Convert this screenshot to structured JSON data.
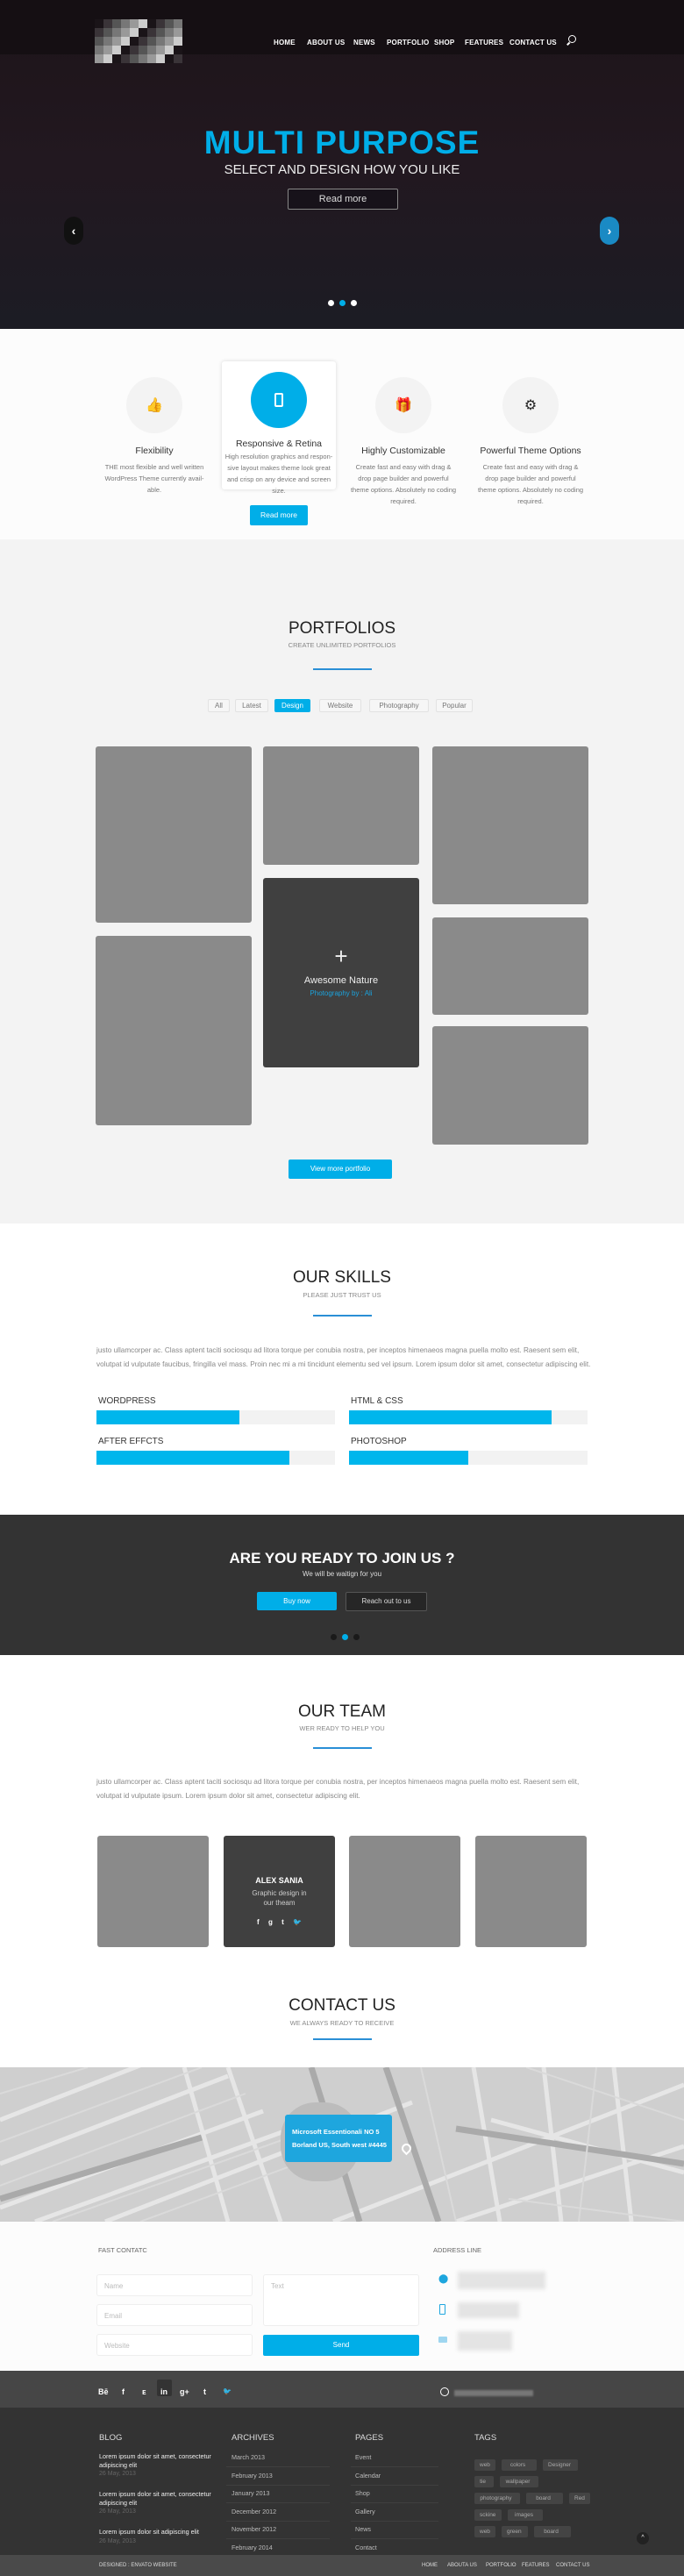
{
  "colors": {
    "accent": "#00aee8",
    "dark": "#333333",
    "hero_bg": "#1d1419"
  },
  "nav": {
    "items": [
      "HOME",
      "ABOUT US",
      "NEWS",
      "PORTFOLIO",
      "SHOP",
      "FEATURES",
      "CONTACT US"
    ],
    "search_icon": "search-icon"
  },
  "hero": {
    "title": "MULTI PURPOSE",
    "subtitle": "SELECT AND DESIGN HOW YOU LIKE",
    "button": "Read more",
    "slides": 3,
    "active_slide": 2
  },
  "features": [
    {
      "icon": "thumbs-up-icon",
      "title": "Flexibility",
      "text": "THE most flexible and well written WordPress Theme currently avail- able."
    },
    {
      "icon": "mobile-icon",
      "title": "Responsive & Retina",
      "text": "High resolution graphics and respon- sive layout makes theme look great and crisp on any device and screen size.",
      "button": "Read more"
    },
    {
      "icon": "gift-icon",
      "title": "Highly Customizable",
      "text": "Create fast and easy with drag & drop page builder and powerful theme options. Absolutely no coding required."
    },
    {
      "icon": "gears-icon",
      "title": "Powerful Theme Options",
      "text": "Create fast and easy with drag & drop page builder and powerful theme options. Absolutely no coding required."
    }
  ],
  "portfolio": {
    "title": "PORTFOLIOS",
    "subtitle": "CREATE UNLIMITED PORTFOLIOS",
    "filters": [
      "All",
      "Latest",
      "Design",
      "Website",
      "Photography",
      "Popular"
    ],
    "active_filter": "Design",
    "hover_title": "Awesome Nature",
    "hover_sub": "Photography by : Ali",
    "button": "View more portfolio"
  },
  "skills": {
    "title": "OUR SKILLS",
    "subtitle": "PLEASE JUST TRUST US",
    "text": "justo ullamcorper ac. Class aptent taciti sociosqu ad litora torque per conubia nostra, per inceptos himenaeos magna puella molto est. Raesent sem elit, volutpat id vulputate faucibus, fringilla vel mass. Proin nec mi a mi tincidunt elementu sed vel ipsum. Lorem ipsum dolor sit amet, consectetur adipiscing elit.",
    "items": [
      {
        "label": "WORDPRESS",
        "percent": 60
      },
      {
        "label": "HTML & CSS",
        "percent": 85
      },
      {
        "label": "AFTER EFFCTS",
        "percent": 81
      },
      {
        "label": "PHOTOSHOP",
        "percent": 50
      }
    ]
  },
  "cta": {
    "title": "ARE YOU READY TO JOIN US ?",
    "subtitle": "We will be waitign for you",
    "buy": "Buy now",
    "reach": "Reach out to us",
    "active_dot": 2
  },
  "team": {
    "title": "OUR TEAM",
    "subtitle": "WER READY TO HELP YOU",
    "text": "justo ullamcorper ac. Class aptent taciti sociosqu ad litora torque per conubia nostra, per inceptos himenaeos magna puella molto est. Raesent sem elit, volutpat id vulputate ipsum. Lorem ipsum dolor sit amet, consectetur adipiscing elit.",
    "member_name": "ALEX SANIA",
    "member_role": "Graphic design in our theam"
  },
  "contact": {
    "title": "CONTACT US",
    "subtitle": "WE ALWAYS READY TO RECEIVE",
    "map_tip_line1": "Microsoft Essentionali NO 5",
    "map_tip_line2": "Borland US,  South west #4445",
    "form_title": "FAST CONTATC",
    "name_ph": "Name",
    "email_ph": "Email",
    "website_ph": "Website",
    "text_ph": "Text",
    "send": "Send",
    "address_title": "ADDRESS LINE"
  },
  "social": [
    "Bē",
    "f",
    "ᴇ",
    "in",
    "g+",
    "t",
    "🐦"
  ],
  "footer": {
    "blog_title": "BLOG",
    "blog": [
      {
        "t": "Lorem ipsum dolor sit amet, consectetur adipiscing elit",
        "d": "26 May, 2013"
      },
      {
        "t": "Lorem ipsum dolor sit amet, consectetur adipiscing elit",
        "d": "26 May, 2013"
      },
      {
        "t": "Lorem ipsum dolor sit adipiscing elit",
        "d": "26 May, 2013"
      }
    ],
    "archives_title": "ARCHIVES",
    "archives": [
      "March 2013",
      "February 2013",
      "January 2013",
      "December 2012",
      "November 2012",
      "February 2014"
    ],
    "pages_title": "PAGES",
    "pages": [
      "Event",
      "Calendar",
      "Shop",
      "Gallery",
      "News",
      "Contact"
    ],
    "tags_title": "TAGS",
    "tags": [
      [
        "web",
        "colors",
        "Designer"
      ],
      [
        "tie",
        "wallpaper"
      ],
      [
        "photography",
        "board",
        "Red"
      ],
      [
        "sckine",
        "images"
      ],
      [
        "web",
        "green",
        "board"
      ]
    ],
    "designed": "DESIGNED : ENVATO WEBSITE",
    "bottom_nav": [
      "HOME",
      "ABOUTA US",
      "PORTFOLIO",
      "FEATURES",
      "CONTACT US"
    ]
  }
}
